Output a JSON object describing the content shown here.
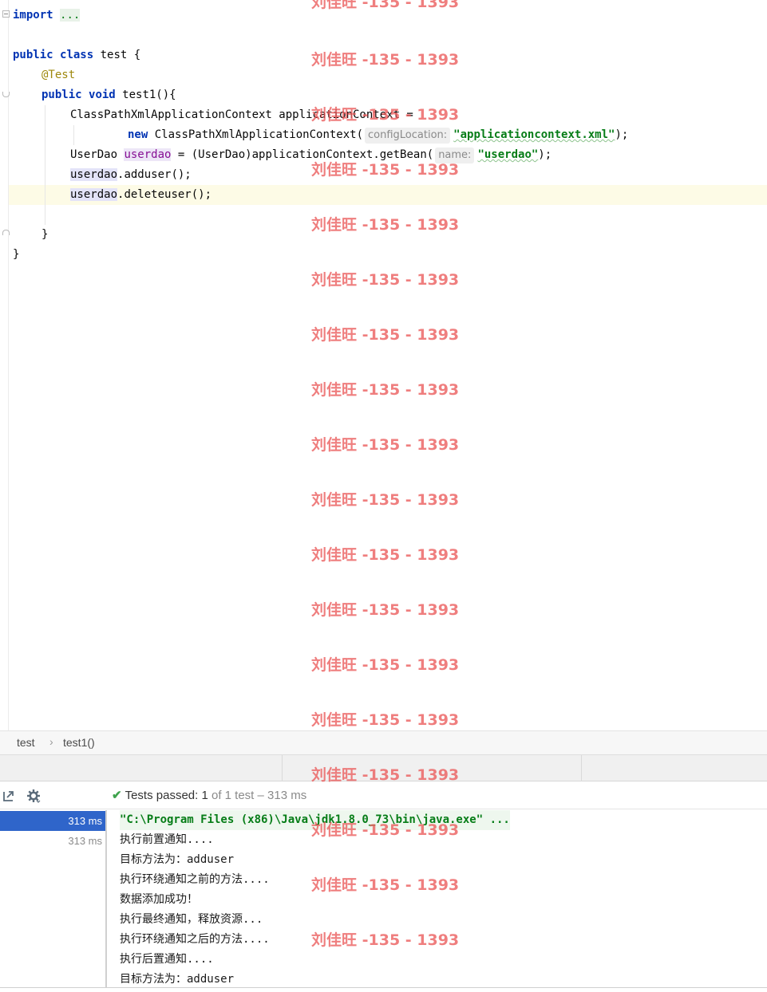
{
  "editor": {
    "lines": {
      "import_kw": "import",
      "import_dots": "...",
      "class_public": "public",
      "class_class": "class",
      "class_rest": " test {",
      "annotation": "@Test",
      "method_public": "public",
      "method_void": "void",
      "method_rest": " test1(){",
      "ctx_decl": "ClassPathXmlApplicationContext applicationContext =",
      "new_kw": "new",
      "new_rest": " ClassPathXmlApplicationContext(",
      "hint_config": "configLocation:",
      "str_xml": "\"applicationcontext.xml\"",
      "end_paren_semi": ");",
      "userdao_type": "UserDao ",
      "userdao_var": "userdao",
      "userdao_rest": " = (UserDao)applicationContext.getBean(",
      "hint_name": "name:",
      "str_userdao": "\"userdao\"",
      "end_paren_semi2": ");",
      "call_var1": "userdao",
      "call_rest1": ".adduser();",
      "call_var2": "userdao",
      "call_rest2": ".deleteuser();",
      "close_method": "}",
      "close_class": "}"
    }
  },
  "breadcrumb": {
    "items": [
      "test",
      "test1()"
    ],
    "separator": "›"
  },
  "run_toolbar": {
    "icons": [
      "export-icon",
      "gear-icon"
    ],
    "status": {
      "check": "✔",
      "label": "Tests passed:",
      "count": "1",
      "rest": "of 1 test – 313 ms"
    }
  },
  "test_tree": {
    "rows": [
      "313 ms",
      "313 ms"
    ]
  },
  "console": {
    "lines": [
      "\"C:\\Program Files (x86)\\Java\\jdk1.8.0_73\\bin\\java.exe\" ...",
      "执行前置通知....",
      "目标方法为：adduser",
      "执行环绕通知之前的方法....",
      "数据添加成功！",
      "执行最终通知，释放资源...",
      "执行环绕通知之后的方法....",
      "执行后置通知....",
      "目标方法为：adduser"
    ]
  },
  "watermark": {
    "text": "刘佳旺 -135 - 1393"
  },
  "colors": {
    "keyword": "#0033b3",
    "annotation": "#9e880d",
    "string": "#067d17",
    "selection": "#2f65ca",
    "watermark": "#eb5a5a"
  }
}
